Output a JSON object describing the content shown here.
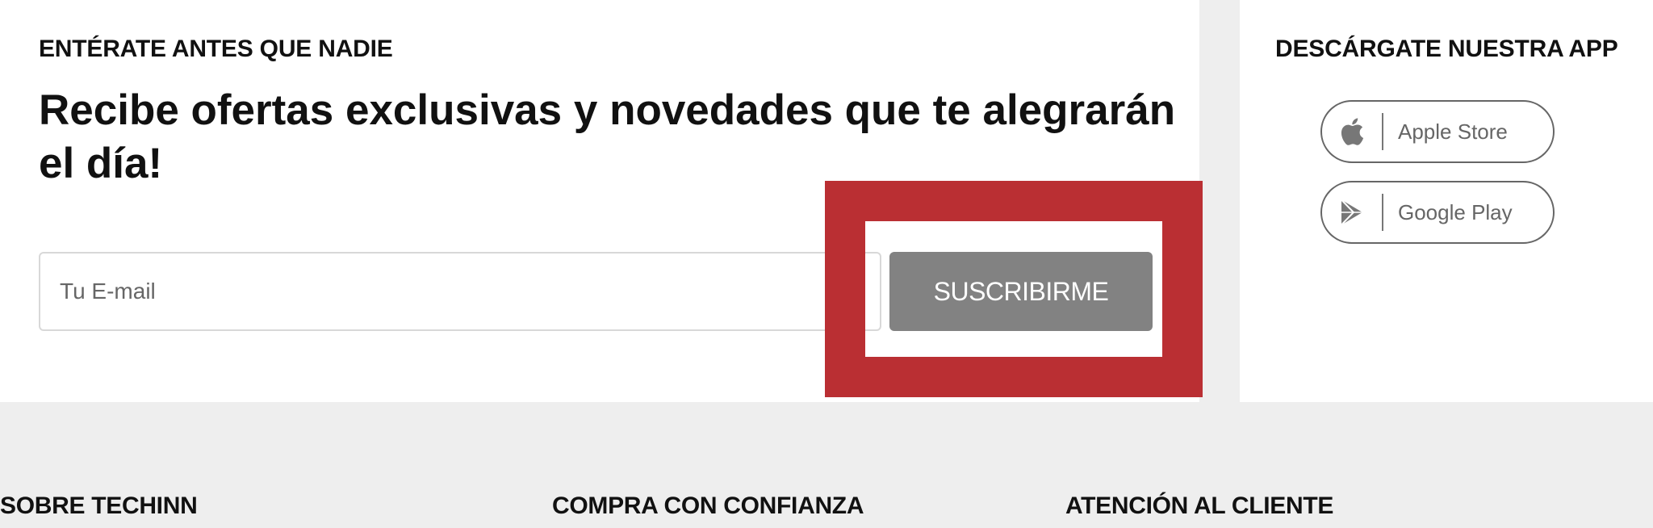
{
  "newsletter": {
    "eyebrow": "ENTÉRATE ANTES QUE NADIE",
    "headline": "Recibe ofertas exclusivas y novedades que te alegrarán el día!",
    "email_placeholder": "Tu E-mail",
    "subscribe_label": "SUSCRIBIRME"
  },
  "app_download": {
    "title": "DESCÁRGATE NUESTRA APP",
    "stores": [
      {
        "label": "Apple Store",
        "icon": "apple-icon"
      },
      {
        "label": "Google Play",
        "icon": "google-play-icon"
      }
    ]
  },
  "footer": {
    "headings": [
      "SOBRE TECHINN",
      "COMPRA CON CONFIANZA",
      "ATENCIÓN AL CLIENTE"
    ]
  },
  "colors": {
    "page_background": "#eeeeee",
    "panel_background": "#ffffff",
    "button_gray": "#828282",
    "highlight_red": "#ba2f33"
  }
}
